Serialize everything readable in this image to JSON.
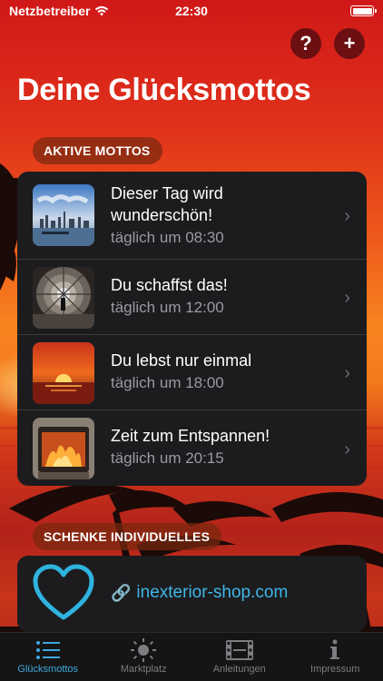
{
  "status_bar": {
    "carrier": "Netzbetreiber",
    "time": "22:30"
  },
  "header": {
    "help_label": "?",
    "add_label": "+",
    "title": "Deine Glücksmottos"
  },
  "active_section": {
    "label": "AKTIVE MOTTOS",
    "items": [
      {
        "title_line1": "Dieser Tag wird",
        "title_line2": "wunderschön!",
        "subtitle": "täglich um 08:30",
        "image": "city-harbor"
      },
      {
        "title": "Du schaffst das!",
        "subtitle": "täglich um 12:00",
        "image": "tunnel"
      },
      {
        "title": "Du lebst nur einmal",
        "subtitle": "täglich um 18:00",
        "image": "sunset"
      },
      {
        "title": "Zeit zum Entspannen!",
        "subtitle": "täglich um 20:15",
        "image": "fireplace"
      }
    ]
  },
  "gift_section": {
    "label": "SCHENKE INDIVIDUELLES",
    "link_text": "inexterior-shop.com",
    "icon": "heart-icon"
  },
  "tab_bar": {
    "tabs": [
      {
        "label": "Glücksmottos",
        "icon": "list-icon",
        "active": true
      },
      {
        "label": "Marktplatz",
        "icon": "sun-icon",
        "active": false
      },
      {
        "label": "Anleitungen",
        "icon": "film-icon",
        "active": false
      },
      {
        "label": "Impressum",
        "icon": "info-icon",
        "active": false
      }
    ]
  },
  "colors": {
    "accent": "#3fa7e0",
    "link": "#3fb6e6",
    "card_bg": "#1c1c1e"
  }
}
